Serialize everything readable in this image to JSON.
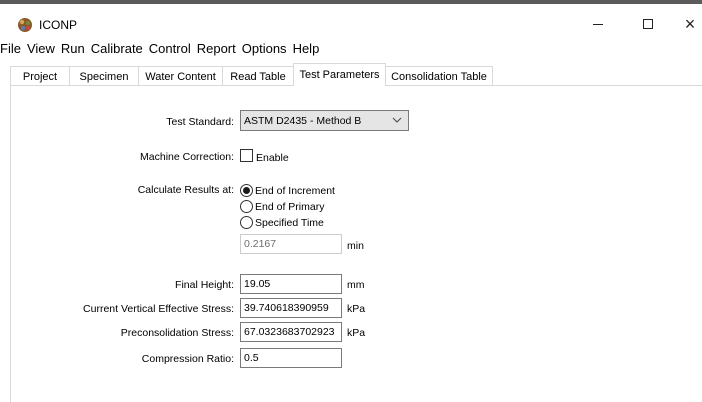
{
  "window": {
    "title": "ICONP",
    "icon": "iconp-app-icon",
    "controls": {
      "minimize": "minimize-icon",
      "maximize": "maximize-icon",
      "close": "×"
    }
  },
  "menu": [
    "File",
    "View",
    "Run",
    "Calibrate",
    "Control",
    "Report",
    "Options",
    "Help"
  ],
  "tabs": [
    {
      "label": "Project",
      "active": false
    },
    {
      "label": "Specimen",
      "active": false
    },
    {
      "label": "Water Content",
      "active": false
    },
    {
      "label": "Read Table",
      "active": false
    },
    {
      "label": "Test Parameters",
      "active": true
    },
    {
      "label": "Consolidation Table",
      "active": false
    }
  ],
  "form": {
    "test_standard": {
      "label": "Test Standard:",
      "value": "ASTM D2435 - Method B"
    },
    "machine_correction": {
      "label": "Machine Correction:",
      "checkbox_label": "Enable",
      "checked": false
    },
    "calculate_results": {
      "label": "Calculate Results at:",
      "options": [
        "End of Increment",
        "End of Primary",
        "Specified Time"
      ],
      "selected": "End of Increment",
      "time_value": "0.2167",
      "time_unit": "min"
    },
    "final_height": {
      "label": "Final Height:",
      "value": "19.05",
      "unit": "mm"
    },
    "current_vertical_effective_stress": {
      "label": "Current Vertical Effective Stress:",
      "value": "39.740618390959",
      "unit": "kPa"
    },
    "preconsolidation_stress": {
      "label": "Preconsolidation Stress:",
      "value": "67.0323683702923",
      "unit": "kPa"
    },
    "compression_ratio": {
      "label": "Compression Ratio:",
      "value": "0.5"
    }
  }
}
